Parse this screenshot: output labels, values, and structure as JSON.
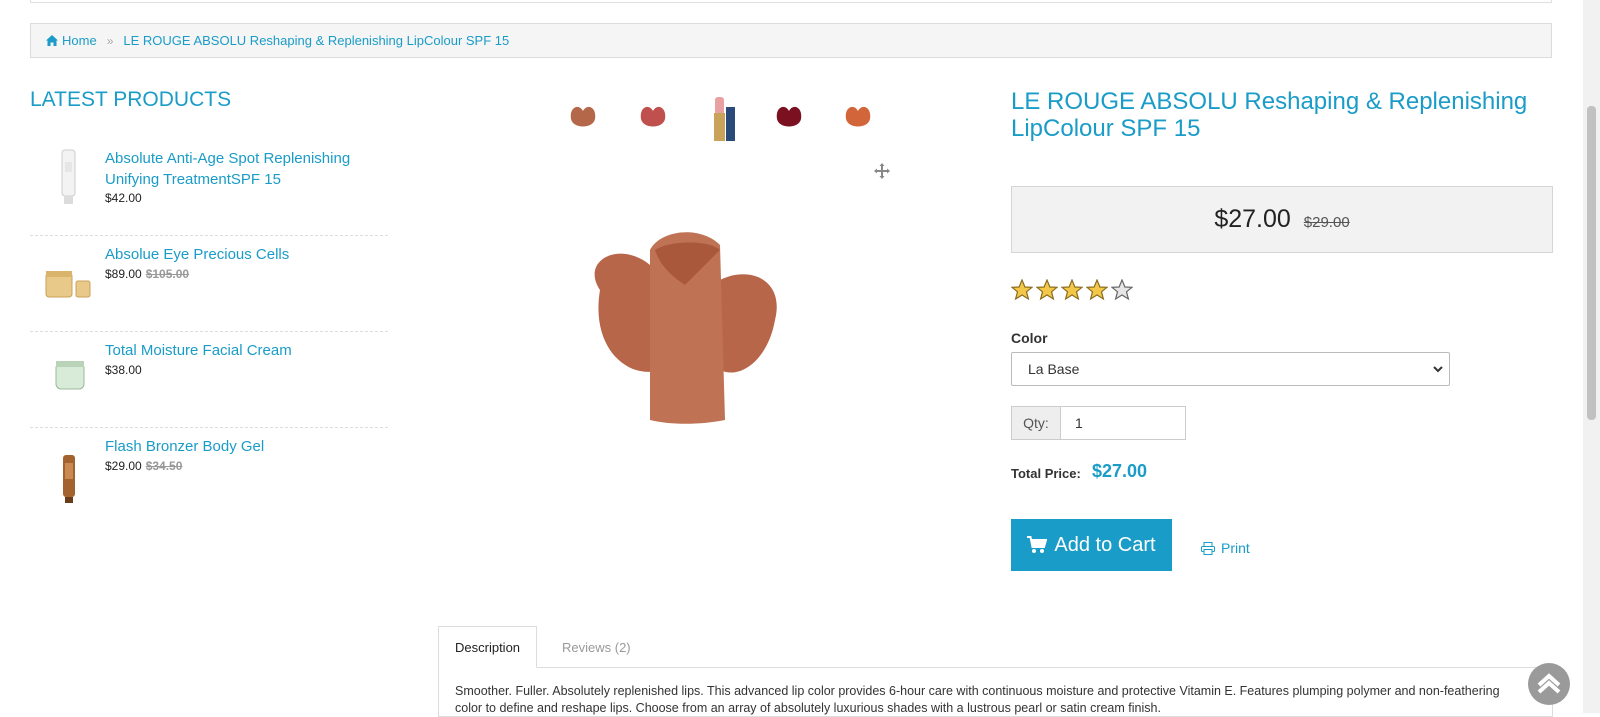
{
  "breadcrumb": {
    "home": "Home",
    "current": "LE ROUGE ABSOLU Reshaping & Replenishing LipColour SPF 15"
  },
  "sidebar": {
    "title": "LATEST PRODUCTS",
    "items": [
      {
        "name": "Absolute Anti-Age Spot Replenishing Unifying TreatmentSPF 15",
        "price": "$42.00",
        "old_price": ""
      },
      {
        "name": "Absolue Eye Precious Cells",
        "price": "$89.00",
        "old_price": "$105.00"
      },
      {
        "name": "Total Moisture Facial Cream",
        "price": "$38.00",
        "old_price": ""
      },
      {
        "name": "Flash Bronzer Body Gel",
        "price": "$29.00",
        "old_price": "$34.50"
      }
    ]
  },
  "product": {
    "title": "LE ROUGE ABSOLU Reshaping & Replenishing LipColour SPF 15",
    "price": "$27.00",
    "old_price": "$29.00",
    "rating": 4,
    "rating_max": 5,
    "color_label": "Color",
    "color_selected": "La Base",
    "qty_label": "Qty:",
    "qty_value": "1",
    "total_label": "Total Price:",
    "total_value": "$27.00",
    "add_to_cart": "Add to Cart",
    "print": "Print",
    "swatch_colors": [
      "#b5674a",
      "#c0504d",
      "#c9a35a",
      "#7a1020",
      "#d2663a"
    ]
  },
  "tabs": {
    "description": "Description",
    "reviews": "Reviews (2)"
  },
  "description_text": "Smoother. Fuller. Absolutely replenished lips. This advanced lip color provides 6-hour care with continuous moisture and protective Vitamin E. Features plumping polymer and non-feathering color to define and reshape lips. Choose from an array of absolutely luxurious shades with a lustrous pearl or satin cream finish.",
  "colors": {
    "accent": "#1a9cc8",
    "price_box": "#f2f2f2"
  }
}
